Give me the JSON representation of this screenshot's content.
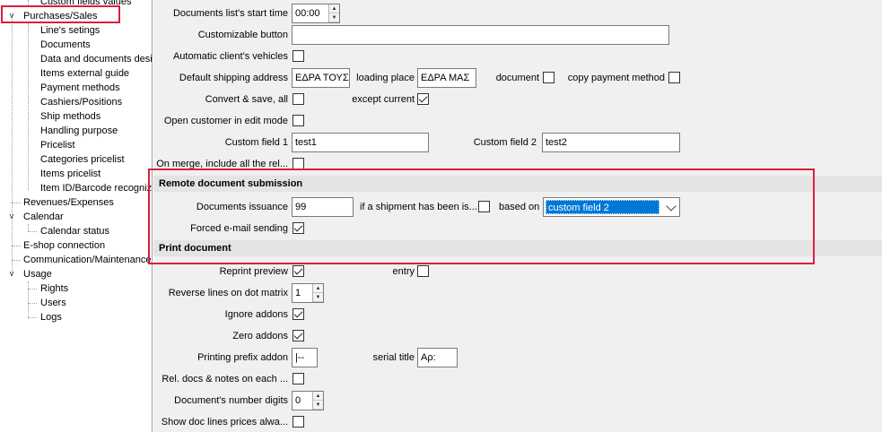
{
  "tree": {
    "items": [
      {
        "label": "Custom fields values"
      },
      {
        "label": "Purchases/Sales"
      },
      {
        "label": "Line's setings"
      },
      {
        "label": "Documents"
      },
      {
        "label": "Data and documents desi"
      },
      {
        "label": "Items external guide"
      },
      {
        "label": "Payment methods"
      },
      {
        "label": "Cashiers/Positions"
      },
      {
        "label": "Ship methods"
      },
      {
        "label": "Handling purpose"
      },
      {
        "label": "Pricelist"
      },
      {
        "label": "Categories pricelist"
      },
      {
        "label": "Items pricelist"
      },
      {
        "label": "Item ID/Barcode recognizi"
      },
      {
        "label": "Revenues/Expenses"
      },
      {
        "label": "Calendar"
      },
      {
        "label": "Calendar status"
      },
      {
        "label": "E-shop connection"
      },
      {
        "label": "Communication/Maintenance"
      },
      {
        "label": "Usage"
      },
      {
        "label": "Rights"
      },
      {
        "label": "Users"
      },
      {
        "label": "Logs"
      }
    ],
    "expand_glyph": "v"
  },
  "form": {
    "start_time_label": "Documents list's start time",
    "start_time_value": "00:00",
    "custom_button_label": "Customizable button",
    "custom_button_value": "",
    "auto_vehicles_label": "Automatic client's vehicles",
    "default_ship_label": "Default shipping address",
    "default_ship_value": "ΕΔΡΑ ΤΟΥΣ",
    "loading_place_label": "loading place",
    "loading_place_value": "ΕΔΡΑ ΜΑΣ",
    "document_label": "document",
    "copy_payment_label": "copy payment method",
    "convert_save_label": "Convert & save, all",
    "except_current_label": "except current",
    "open_customer_label": "Open customer in edit mode",
    "custom_field1_label": "Custom field 1",
    "custom_field1_value": "test1",
    "custom_field2_label": "Custom field 2",
    "custom_field2_value": "test2",
    "on_merge_label": "On merge, include all the rel...",
    "remote_section": "Remote document submission",
    "docs_issuance_label": "Documents issuance",
    "docs_issuance_value": "99",
    "if_shipment_label": "if a shipment has been is...",
    "based_on_label": "based on",
    "based_on_value": "custom field 2",
    "forced_email_label": "Forced e-mail sending",
    "print_section": "Print document",
    "reprint_label": "Reprint preview",
    "entry_label": "entry",
    "reverse_lines_label": "Reverse lines on dot matrix",
    "reverse_lines_value": "1",
    "ignore_addons_label": "Ignore addons",
    "zero_addons_label": "Zero addons",
    "printing_prefix_label": "Printing prefix addon",
    "printing_prefix_value": "|--",
    "serial_title_label": "serial title",
    "serial_title_value": "Αρ:",
    "rel_docs_label": "Rel. docs & notes on each ...",
    "number_digits_label": "Document's number digits",
    "number_digits_value": "0",
    "show_prices_label": "Show doc lines prices alwa..."
  },
  "checkboxes": {
    "auto_vehicles": false,
    "document": false,
    "copy_payment": false,
    "convert_save": false,
    "except_current": true,
    "open_customer": false,
    "on_merge": false,
    "if_shipment": false,
    "forced_email": true,
    "reprint": true,
    "entry": false,
    "ignore_addons": true,
    "zero_addons": true,
    "rel_docs": false,
    "show_prices": false
  },
  "colors": {
    "highlight_border": "#d6213e",
    "selection": "#0078d7",
    "panel_bg": "#f0f0f0"
  }
}
